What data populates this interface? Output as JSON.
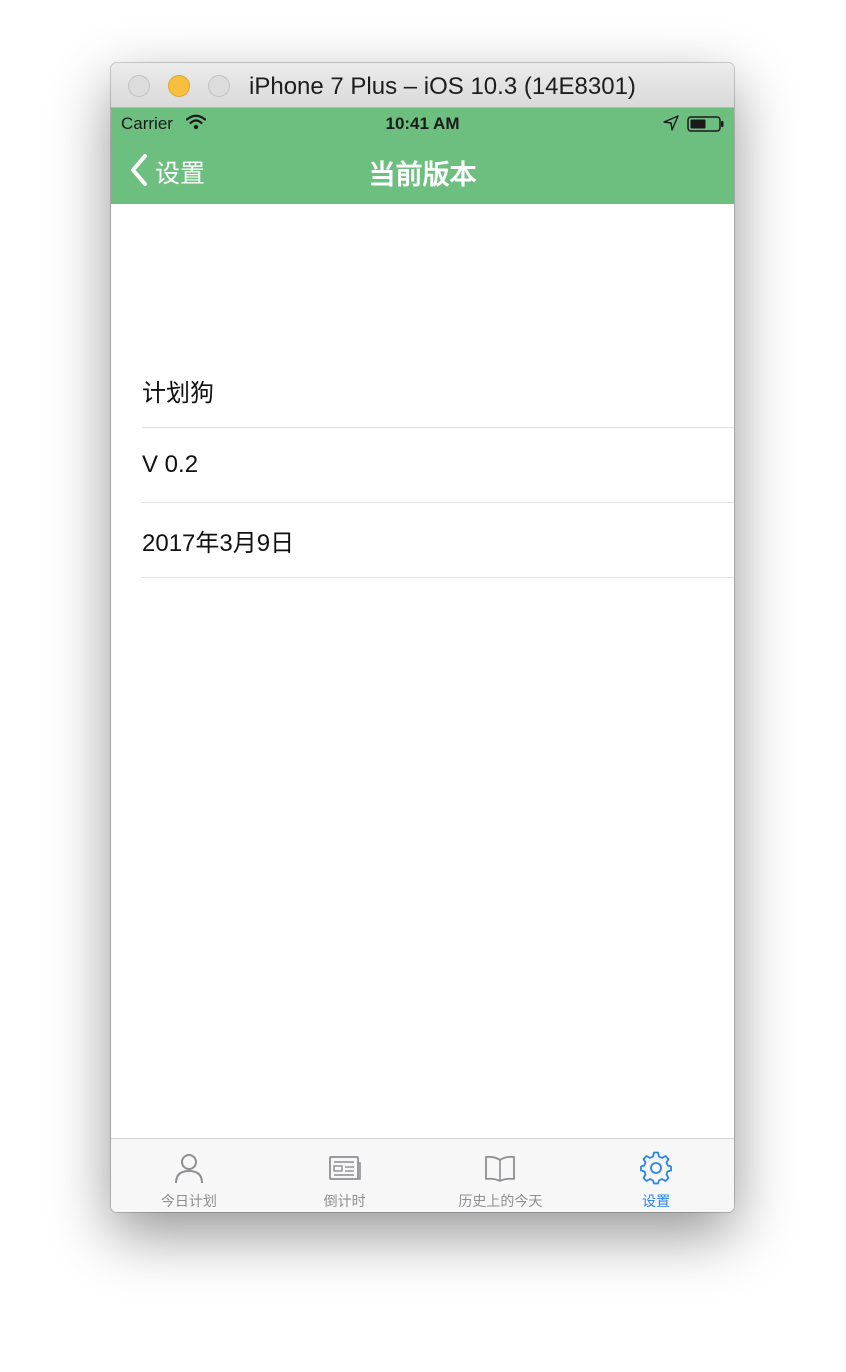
{
  "window": {
    "title": "iPhone 7 Plus – iOS 10.3 (14E8301)"
  },
  "status_bar": {
    "carrier": "Carrier",
    "time": "10:41 AM",
    "icons": [
      "wifi-icon",
      "location-icon",
      "battery-icon"
    ]
  },
  "nav": {
    "back_label": "设置",
    "title": "当前版本",
    "background_color": "#6dbf80"
  },
  "info_rows": [
    "计划狗",
    "V 0.2",
    "2017年3月9日"
  ],
  "tabbar": {
    "active_color": "#2b84e8",
    "inactive_color": "#8e8e93",
    "tabs": [
      {
        "label": "今日计划",
        "icon": "person-icon"
      },
      {
        "label": "倒计时",
        "icon": "newspaper-icon"
      },
      {
        "label": "历史上的今天",
        "icon": "book-icon"
      },
      {
        "label": "设置",
        "icon": "gear-icon"
      }
    ],
    "active_index": 3
  }
}
